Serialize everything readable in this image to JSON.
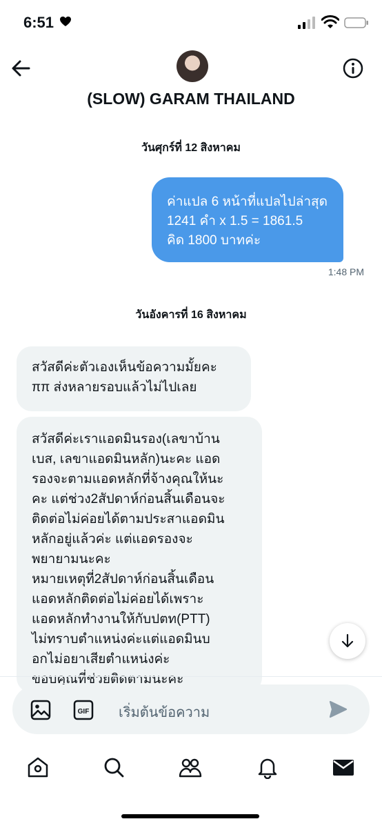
{
  "status": {
    "time": "6:51"
  },
  "header": {
    "title": "(SLOW) GARAM THAILAND"
  },
  "messages": {
    "date1": "วันศุกร์ที่ 12 สิงหาคม",
    "out1": {
      "lines": [
        "ค่าแปล 6 หน้าที่แปลไปล่าสุด",
        "1241 คำ x 1.5 = 1861.5",
        "คิด 1800 บาทค่ะ"
      ],
      "time": "1:48 PM"
    },
    "date2": "วันอังคารที่ 16 สิงหาคม",
    "in1": {
      "lines": [
        "สวัสดีค่ะตัวเองเห็นข้อความมั้ยคะ",
        "ππ ส่งหลายรอบแล้วไม่ไปเลย"
      ]
    },
    "in2": {
      "lines": [
        "สวัสดีค่ะเราแอดมินรอง(เลขาบ้าน",
        "เบส, เลขาแอดมินหลัก)นะคะ แอด",
        "รองจะตามแอดหลักที่จ้างคุณให้นะ",
        "คะ แต่ช่วง2สัปดาห์ก่อนสิ้นเดือนจะ",
        "ติดต่อไม่ค่อยได้ตามประสาแอดมิน",
        "หลักอยู่แล้วค่ะ แต่แอดรองจะ",
        "พยายามนะคะ",
        "หมายเหตุที่2สัปดาห์ก่อนสิ้นเดือน",
        "แอดหลักติดต่อไม่ค่อยได้เพราะ",
        "แอดหลักทำงานให้กับปตท(PTT)",
        "ไม่ทราบตำแหน่งค่ะแต่แอดมินบ",
        "อกไม่อยาเสียตำแหน่งค่ะ",
        "ขอบคุณที่ช่วยติดตามนะคะ"
      ]
    }
  },
  "composer": {
    "placeholder": "เริ่มต้นข้อความ",
    "gif_label": "GIF"
  },
  "icons": {
    "back": "arrow-left",
    "info": "info-circle",
    "scroll": "arrow-down",
    "image": "image",
    "gif": "gif",
    "send": "send",
    "nav": [
      "home",
      "search",
      "communities",
      "notifications",
      "messages"
    ]
  },
  "colors": {
    "accent": "#4a99e9",
    "incoming_bg": "#eff3f4",
    "muted": "#536471"
  }
}
